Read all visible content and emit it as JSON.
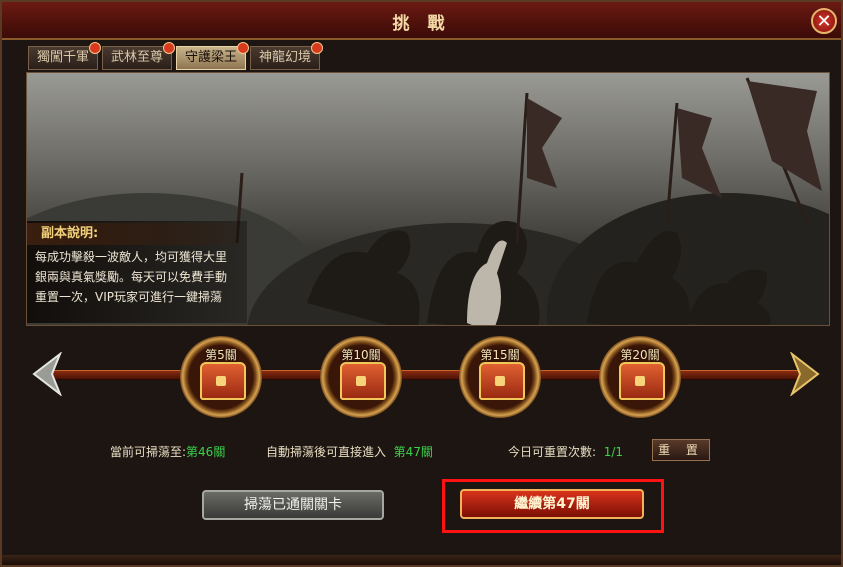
{
  "window": {
    "title": "挑 戰",
    "close_symbol": "✕"
  },
  "tabs": [
    {
      "label": "獨闖千軍",
      "active": false
    },
    {
      "label": "武林至尊",
      "active": false
    },
    {
      "label": "守護梁王",
      "active": true
    },
    {
      "label": "神龍幻境",
      "active": false
    }
  ],
  "description": {
    "title": "副本說明:",
    "lines": [
      "每成功擊殺一波敵人，均可獲得大里",
      "銀兩與真氣獎勵。每天可以免費手動",
      "重置一次，VIP玩家可進行一鍵掃蕩"
    ]
  },
  "milestones": [
    {
      "label": "第5關"
    },
    {
      "label": "第10關"
    },
    {
      "label": "第15關"
    },
    {
      "label": "第20關"
    }
  ],
  "status": {
    "current_label": "當前可掃蕩至:",
    "current_value": "第46關",
    "auto_label": "自動掃蕩後可直接進入",
    "auto_value": "第47關",
    "reset_label": "今日可重置次數:",
    "reset_value": "1/1"
  },
  "buttons": {
    "reset": "重 置",
    "sweep": "掃蕩已通關關卡",
    "continue": "繼續第47關"
  },
  "colors": {
    "accent_green": "#3bd14a",
    "highlight_red": "#ff1212"
  }
}
